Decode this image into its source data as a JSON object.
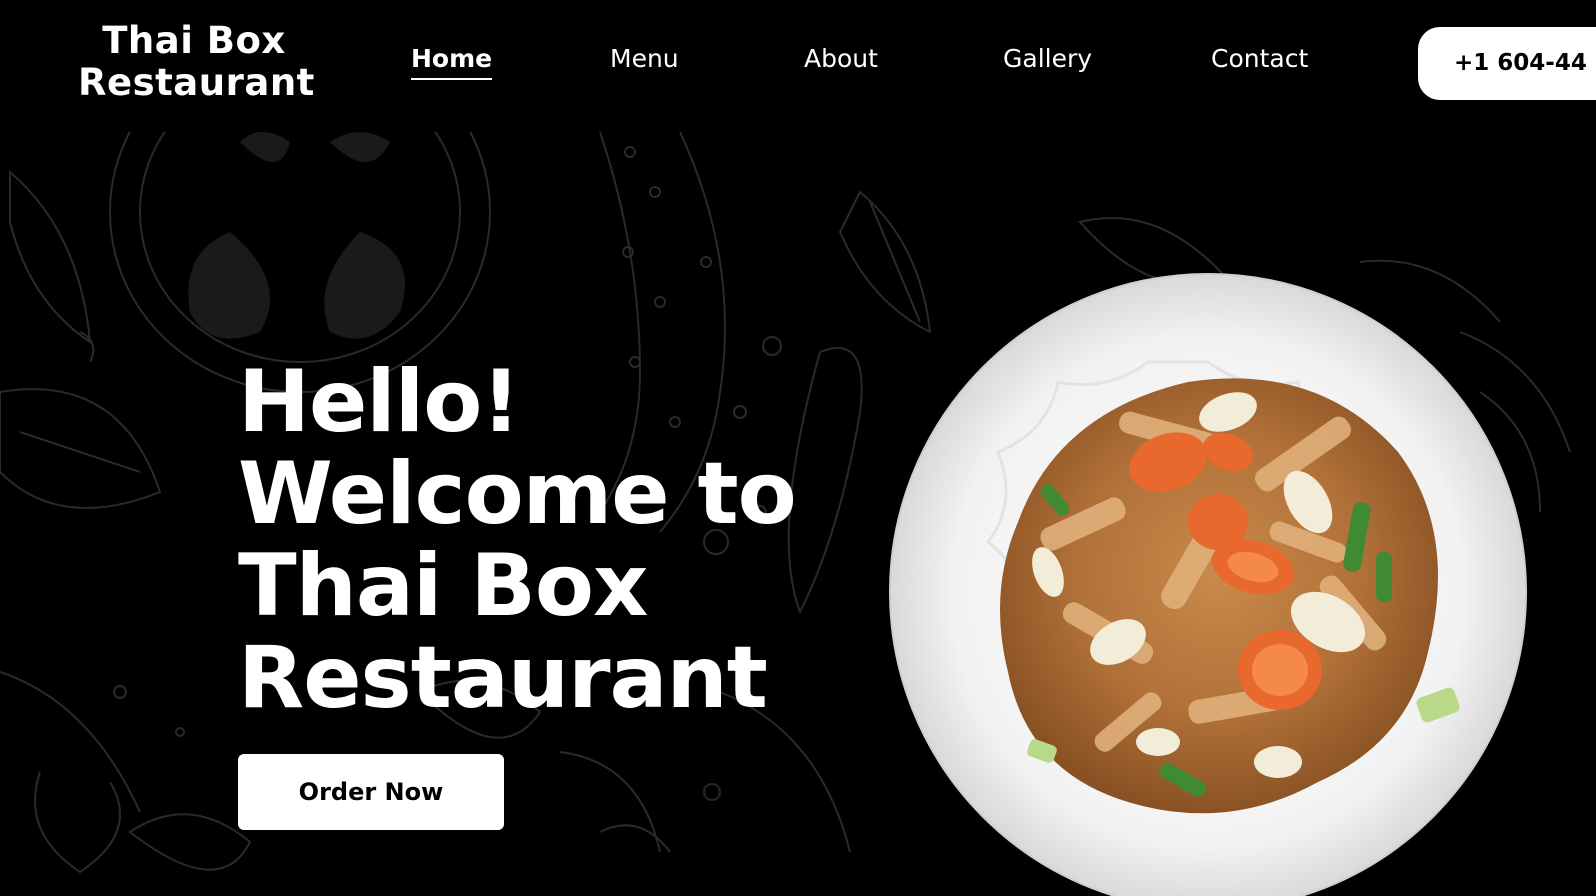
{
  "header": {
    "logo_line1": "Thai Box",
    "logo_line2": "Restaurant",
    "nav": [
      {
        "label": "Home",
        "active": true
      },
      {
        "label": "Menu",
        "active": false
      },
      {
        "label": "About",
        "active": false
      },
      {
        "label": "Gallery",
        "active": false
      },
      {
        "label": "Contact",
        "active": false
      }
    ],
    "phone_label": "+1 604-44"
  },
  "hero": {
    "title_lines": [
      "Hello!",
      "Welcome to",
      "Thai Box",
      "Restaurant"
    ],
    "order_button": "Order Now"
  },
  "colors": {
    "background": "#000000",
    "text": "#ffffff",
    "button_bg": "#ffffff",
    "button_text": "#000000",
    "pattern_stroke": "#2a2a2a"
  },
  "icons": {
    "food_image": "plate-of-thai-noodles-image",
    "background": "vegetable-doodle-pattern"
  }
}
